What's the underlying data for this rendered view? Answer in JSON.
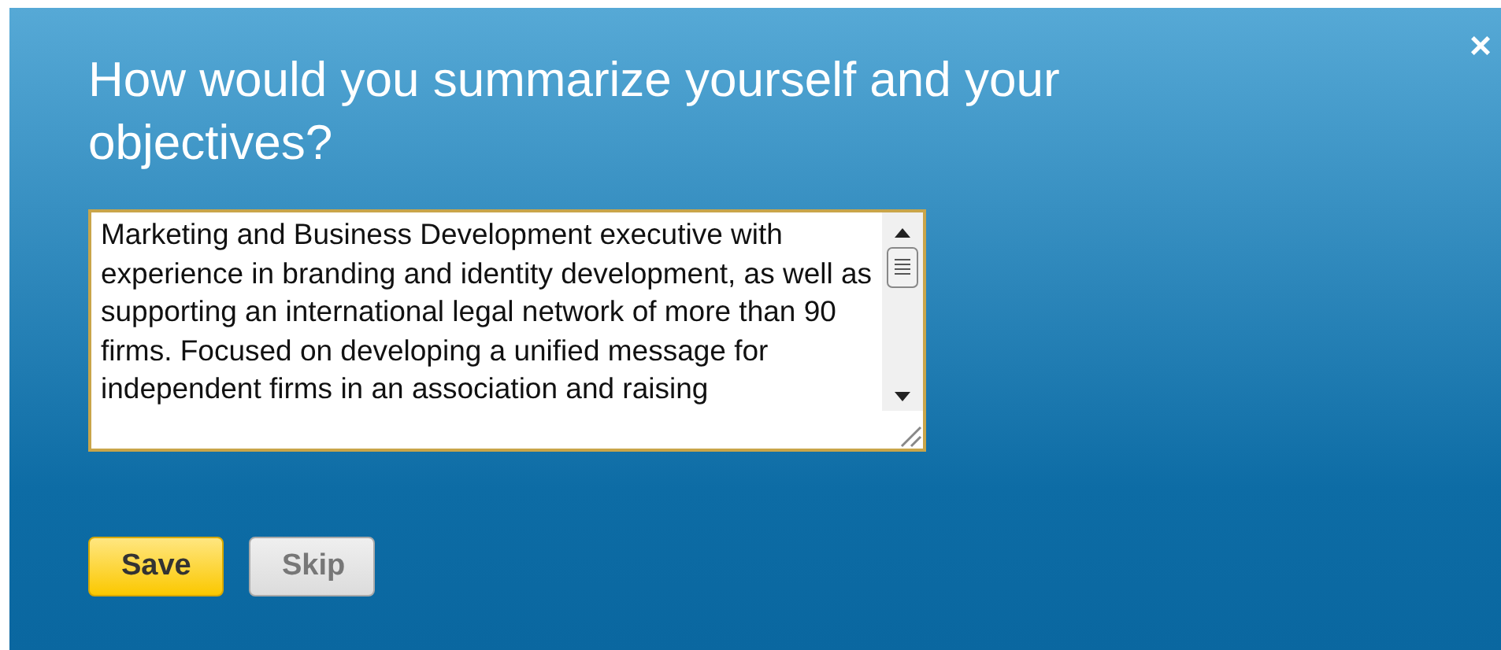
{
  "dialog": {
    "title": "How would you summarize yourself and your objectives?",
    "close": "×"
  },
  "summary": {
    "value": "Marketing and Business Development executive with experience in branding and identity development, as well as supporting an international legal network of more than 90 firms. Focused on developing a unified message for independent firms in an association and raising"
  },
  "buttons": [
    {
      "label": "Save",
      "kind": "primary"
    },
    {
      "label": "Skip",
      "kind": "secondary"
    }
  ]
}
